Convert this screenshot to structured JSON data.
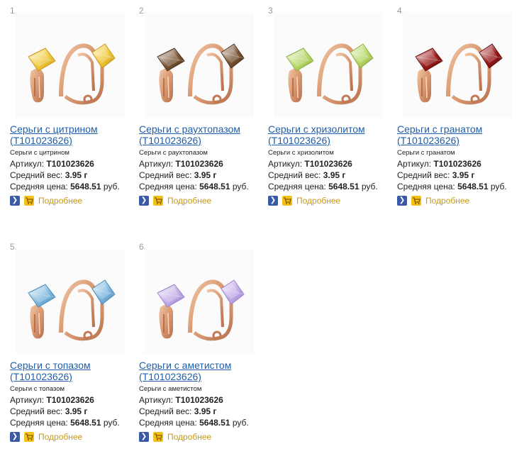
{
  "labels": {
    "article": "Артикул:",
    "weight": "Средний вес:",
    "price": "Средняя цена:",
    "currency": "руб.",
    "more": "Подробнее",
    "arrow_icon": "arrow-right-icon",
    "cart_icon": "cart-icon"
  },
  "products": [
    {
      "num": "1.",
      "title": "Серьги с цитрином (Т101023626)",
      "desc": "Серьги с цитрином",
      "article": "Т101023626",
      "weight": "3.95 г",
      "price": "5648.51",
      "stone_color": "#f0c93a",
      "stone_dark": "#c99512"
    },
    {
      "num": "2.",
      "title": "Серьги с раухтопазом (Т101023626)",
      "desc": "Серьги с раухтопазом",
      "article": "Т101023626",
      "weight": "3.95 г",
      "price": "5648.51",
      "stone_color": "#7a5535",
      "stone_dark": "#4a2f18"
    },
    {
      "num": "3.",
      "title": "Серьги с хризолитом (Т101023626)",
      "desc": "Серьги с хризолитом",
      "article": "Т101023626",
      "weight": "3.95 г",
      "price": "5648.51",
      "stone_color": "#b9d86a",
      "stone_dark": "#8aad3a"
    },
    {
      "num": "4.",
      "title": "Серьги с гранатом (Т101023626)",
      "desc": "Серьги с гранатом",
      "article": "Т101023626",
      "weight": "3.95 г",
      "price": "5648.51",
      "stone_color": "#9b1a1a",
      "stone_dark": "#5e0a0a"
    },
    {
      "num": "5.",
      "title": "Серьги с топазом (Т101023626)",
      "desc": "Серьги с топазом",
      "article": "Т101023626",
      "weight": "3.95 г",
      "price": "5648.51",
      "stone_color": "#7fb9e0",
      "stone_dark": "#4b89b8"
    },
    {
      "num": "6.",
      "title": "Серьги с аметистом (Т101023626)",
      "desc": "Серьги с аметистом",
      "article": "Т101023626",
      "weight": "3.95 г",
      "price": "5648.51",
      "stone_color": "#c3aee8",
      "stone_dark": "#9a7fc8"
    }
  ]
}
